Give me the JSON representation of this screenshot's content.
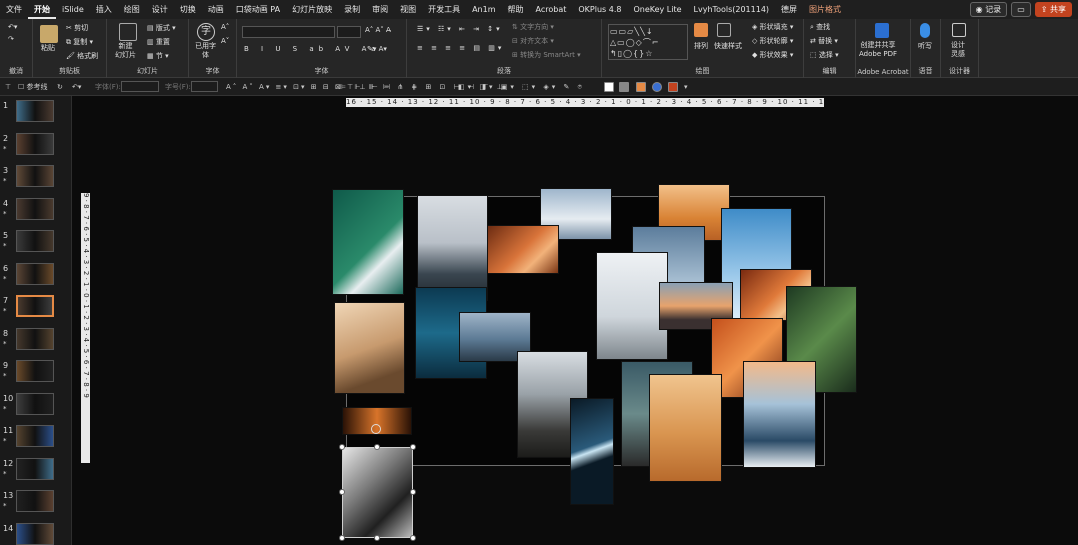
{
  "menubar": {
    "items": [
      "文件",
      "开始",
      "iSlide",
      "插入",
      "绘图",
      "设计",
      "切换",
      "动画",
      "口袋动画 PA",
      "幻灯片放映",
      "录制",
      "审阅",
      "视图",
      "开发工具",
      "An1m",
      "帮助",
      "Acrobat",
      "OKPlus 4.8",
      "OneKey Lite",
      "LvyhTools(201114)",
      "德屏",
      "图片格式"
    ],
    "active_index": 1,
    "accent_index": 21,
    "record_label": "记录",
    "comment_icon": "comment-icon",
    "share_label": "共享"
  },
  "ribbon": {
    "undo": {
      "label": "撤消"
    },
    "clipboard": {
      "paste": "粘贴",
      "cut": "剪切",
      "copy": "复制",
      "format_painter": "格式刷",
      "label": "剪贴板"
    },
    "slides": {
      "new_slide": "新建\n幻灯片",
      "layout": "版式",
      "reset": "重置",
      "section": "节",
      "label": "幻灯片"
    },
    "fonts_group": {
      "use_font": "已用字\n体",
      "label": "字体"
    },
    "font": {
      "label": "字体"
    },
    "paragraph": {
      "text_direction": "文字方向",
      "align_text": "对齐文本",
      "smartart": "转换为 SmartArt",
      "label": "段落"
    },
    "drawing": {
      "arrange": "排列",
      "quick_styles": "快速样式",
      "fill": "形状填充",
      "outline": "形状轮廓",
      "effects": "形状效果",
      "label": "绘图"
    },
    "editing": {
      "find": "查找",
      "replace": "替换",
      "select": "选择",
      "label": "编辑"
    },
    "acrobat": {
      "create_share": "创建并共享\nAdobe PDF",
      "label": "Adobe Acrobat"
    },
    "voice": {
      "dictate": "听写",
      "label": "语音"
    },
    "designer": {
      "design_ideas": "设计\n灵感",
      "label": "设计器"
    }
  },
  "toolbar": {
    "reference_line": "参考线",
    "font_placeholder": "字体(F):",
    "size_placeholder": "字号(F):"
  },
  "thumbnails": [
    {
      "num": "1",
      "star": ""
    },
    {
      "num": "2",
      "star": "*"
    },
    {
      "num": "3",
      "star": "*"
    },
    {
      "num": "4",
      "star": "*"
    },
    {
      "num": "5",
      "star": "*"
    },
    {
      "num": "6",
      "star": "*"
    },
    {
      "num": "7",
      "star": "*"
    },
    {
      "num": "8",
      "star": "*"
    },
    {
      "num": "9",
      "star": "*"
    },
    {
      "num": "10",
      "star": "*"
    },
    {
      "num": "11",
      "star": "*"
    },
    {
      "num": "12",
      "star": "*"
    },
    {
      "num": "13",
      "star": "*"
    },
    {
      "num": "14",
      "star": ""
    }
  ],
  "selected_thumbnail": "7",
  "rulers": {
    "horizontal": "16 · 15 · 14 · 13 · 12 · 11 · 10 · 9 · 8 · 7 · 6 · 5 · 4 · 3 · 2 · 1 · 0 · 1 · 2 · 3 · 4 · 5 · 6 · 7 · 8 · 9 · 10 · 11 · 12 · 13 · 14 · 15 · 16",
    "vertical": "9 · 8 · 7 · 6 · 5 · 4 · 3 · 2 · 1 · 0 · 1 · 2 · 3 · 4 · 5 · 6 · 7 · 8 · 9"
  },
  "colors": {
    "accent_orange": "#e58a45",
    "share_red": "#c3431f",
    "ribbon_bg": "#262626",
    "canvas_bg": "#0b0b0b"
  }
}
